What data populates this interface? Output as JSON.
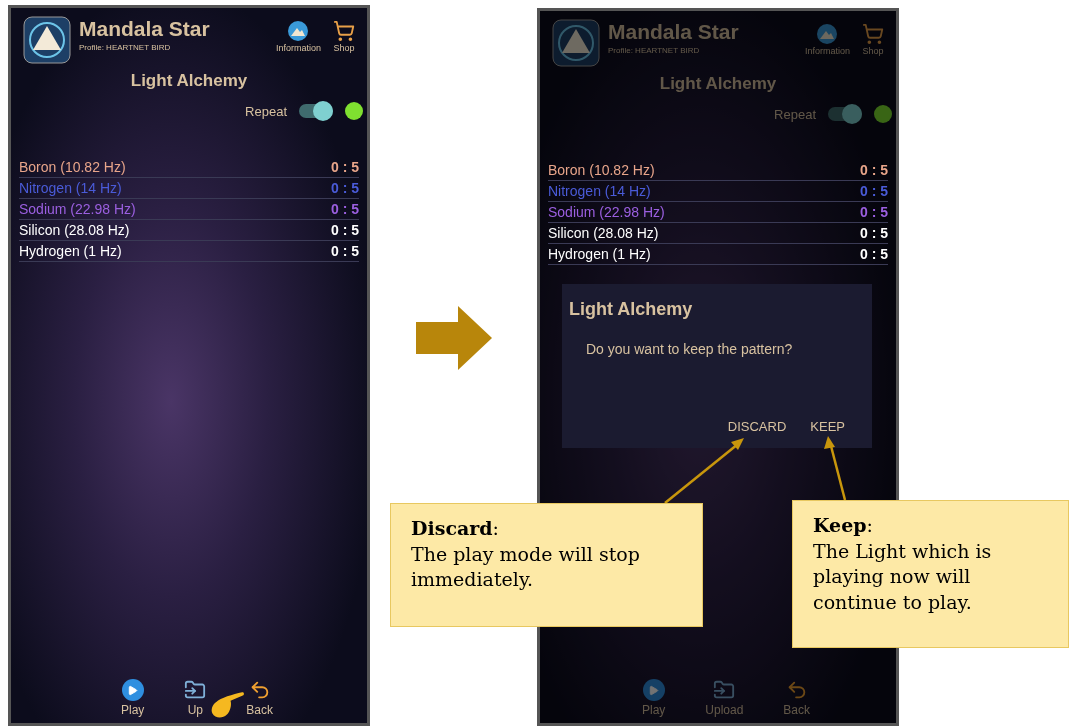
{
  "screens": [
    {
      "dimmed": false,
      "app_title": "Mandala Star",
      "profile": "Profile: HEARTNET BIRD",
      "nav": [
        {
          "label": "Information",
          "kind": "info"
        },
        {
          "label": "Shop",
          "kind": "shop"
        }
      ],
      "page_title": "Light Alchemy",
      "repeat": {
        "label": "Repeat",
        "on": true
      },
      "tracks": [
        {
          "name": "Boron (10.82 Hz)",
          "duration": "0 : 5",
          "color": "#e8a58a"
        },
        {
          "name": "Nitrogen (14 Hz)",
          "duration": "0 : 5",
          "color": "#4a5bd8"
        },
        {
          "name": "Sodium (22.98 Hz)",
          "duration": "0 : 5",
          "color": "#9b5fe0"
        },
        {
          "name": "Silicon (28.08 Hz)",
          "duration": "0 : 5",
          "color": "#ffffff"
        },
        {
          "name": "Hydrogen (1 Hz)",
          "duration": "0 : 5",
          "color": "#ffffff"
        }
      ],
      "bottom_nav": [
        {
          "label": "Play",
          "kind": "play"
        },
        {
          "label": "Up",
          "kind": "upload"
        },
        {
          "label": "Back",
          "kind": "back"
        }
      ],
      "pointer": true
    },
    {
      "dimmed": true,
      "app_title": "Mandala Star",
      "profile": "Profile: HEARTNET BIRD",
      "nav": [
        {
          "label": "Information",
          "kind": "info"
        },
        {
          "label": "Shop",
          "kind": "shop"
        }
      ],
      "page_title": "Light Alchemy",
      "repeat": {
        "label": "Repeat",
        "on": true
      },
      "tracks": [
        {
          "name": "Boron (10.82 Hz)",
          "duration": "0 : 5",
          "color": "#e8a58a"
        },
        {
          "name": "Nitrogen (14 Hz)",
          "duration": "0 : 5",
          "color": "#4a5bd8"
        },
        {
          "name": "Sodium (22.98 Hz)",
          "duration": "0 : 5",
          "color": "#9b5fe0"
        },
        {
          "name": "Silicon (28.08 Hz)",
          "duration": "0 : 5",
          "color": "#ffffff"
        },
        {
          "name": "Hydrogen (1 Hz)",
          "duration": "0 : 5",
          "color": "#ffffff"
        }
      ],
      "bottom_nav": [
        {
          "label": "Play",
          "kind": "play"
        },
        {
          "label": "Upload",
          "kind": "upload"
        },
        {
          "label": "Back",
          "kind": "back"
        }
      ],
      "pointer": false,
      "dialog": {
        "title": "Light Alchemy",
        "message": "Do you want to keep the pattern?",
        "buttons": [
          "DISCARD",
          "KEEP"
        ]
      }
    }
  ],
  "callouts": [
    {
      "heading": "**Discard**:",
      "text": "The play mode will stop immediately."
    },
    {
      "heading": "**Keep**:",
      "text": "The Light which is playing now will continue to play."
    }
  ]
}
